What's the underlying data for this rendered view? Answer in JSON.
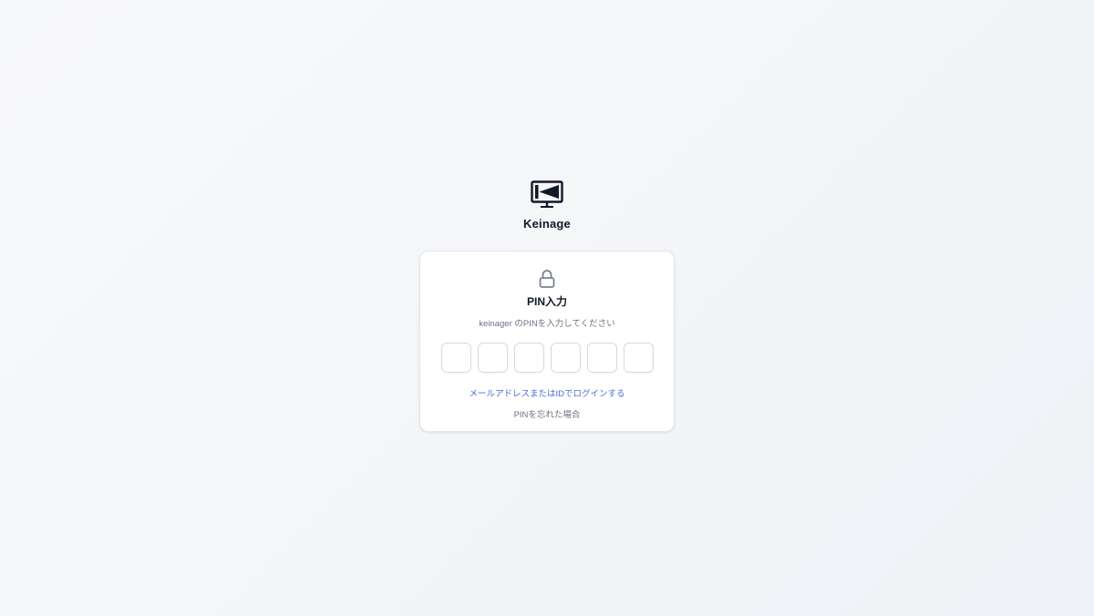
{
  "brand": {
    "name": "Keinage",
    "logo_icon": "monitor-play-back-icon"
  },
  "card": {
    "icon": "lock-icon",
    "title": "PIN入力",
    "subtitle": "keinager のPINを入力してください",
    "pin_length": 6,
    "pin_values": [
      "",
      "",
      "",
      "",
      "",
      ""
    ],
    "alt_login_label": "メールアドレスまたはIDでログインする",
    "forgot_label": "PINを忘れた場合"
  },
  "colors": {
    "link": "#4b6fd6",
    "muted": "#6b7280",
    "title": "#111827",
    "pin_border": "#d6d9de"
  }
}
